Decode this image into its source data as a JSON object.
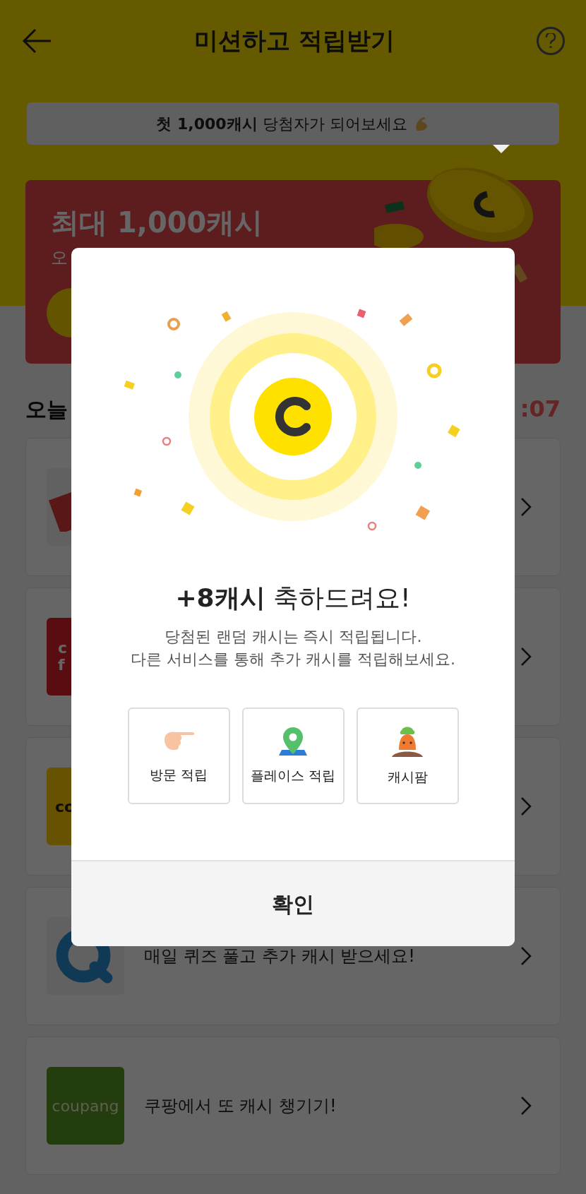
{
  "header": {
    "title": "미션하고 적립받기"
  },
  "tooltip": {
    "text": "**첫 1,000캐시** 당첨자가 되어보세요"
  },
  "banner": {
    "title": "최대 1,000캐시",
    "subtitle": "오"
  },
  "today": {
    "title": "오늘",
    "timer": ":07"
  },
  "missions": [
    {
      "kind": "tilted"
    },
    {
      "kind": "red",
      "logo_text": [
        "c",
        "f"
      ]
    },
    {
      "kind": "yellow",
      "logo_text": [
        "co"
      ]
    },
    {
      "kind": "quiz",
      "text": "매일 퀴즈 풀고 추가 캐시 받으세요!"
    },
    {
      "kind": "coupang",
      "logo_text": [
        "coupang"
      ],
      "text": "쿠팡에서 또 캐시 챙기기!"
    }
  ],
  "modal": {
    "title": "**+8캐시** 축하드려요!",
    "description": [
      "당첨된 랜덤 캐시는 즉시 적립됩니다.",
      "다른 서비스를 통해 추가 캐시를 적립해보세요."
    ],
    "services": [
      {
        "kind": "hand",
        "label": "방문 적립"
      },
      {
        "kind": "pin",
        "label": "플레이스 적립"
      },
      {
        "kind": "carrot",
        "label": "캐시팜"
      }
    ],
    "confirm": "확인"
  }
}
